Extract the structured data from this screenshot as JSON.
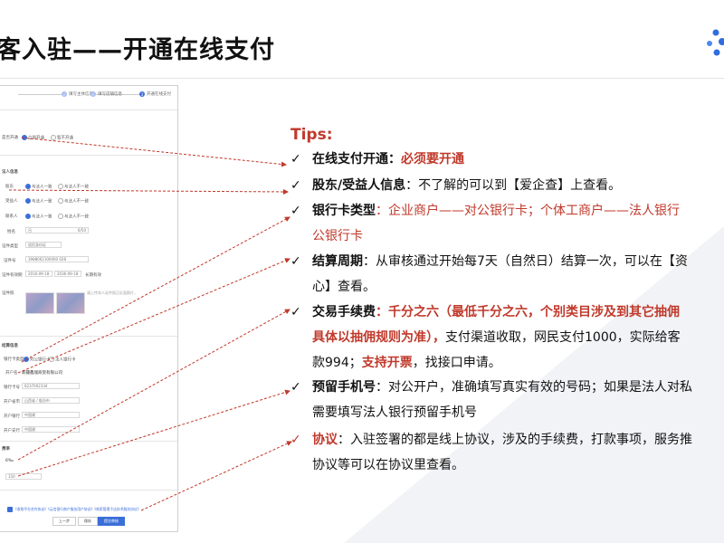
{
  "header": {
    "title": "客入驻——开通在线支付"
  },
  "form": {
    "steps": [
      "填写主体信息",
      "填写店铺信息",
      "开通在线支付"
    ],
    "open_label": "是否开通",
    "open_options": [
      "立即开通",
      "暂不开通"
    ],
    "legal_title": "法人信息",
    "holder_rows": [
      {
        "label": "股东",
        "opt1": "与法人一致",
        "opt2": "与法人不一致"
      },
      {
        "label": "受益人",
        "opt1": "与法人一致",
        "opt2": "与法人不一致"
      },
      {
        "label": "联系人",
        "opt1": "与法人一致",
        "opt2": "与法人不一致"
      }
    ],
    "name_label": "姓名",
    "name_value": "吕",
    "name_counter": "6/50",
    "id_type_label": "证件类型",
    "id_type_value": "居民身份证",
    "id_no_label": "证件号",
    "id_no_value": "3988002100000",
    "id_no_suffix": "028",
    "validity_label": "证件有效期",
    "validity_start": "2016-09-18",
    "validity_end": "2036-09-18",
    "validity_long": "长期有效",
    "photo_label": "证件照",
    "photo_hint": "请上传本人证件照正反面照片，",
    "settle_title": "结算信息",
    "card_type_label": "银行卡类型",
    "card_type_opt1": "对公银行卡",
    "card_type_opt2": "法人银行卡",
    "account_holder_label": "开户名",
    "account_holder_value": "新疆鑫瑞商贸有限公司",
    "card_no_label": "银行卡号",
    "card_no_value": "6237002334",
    "bank_area_label": "开户省市",
    "bank_area_value": "山西省 / 临汾市",
    "bank_label": "开户银行",
    "bank_value": "中国建",
    "branch_label": "开户支行",
    "branch_value": "中国建",
    "fee_title": "费率",
    "fee_value": "6‰",
    "phone_value": "150",
    "agreement_text": "《收购平台合作协议》《云信银行商户服务用户协议》《商家管理子店技术服务协议》",
    "btn_prev": "上一步",
    "btn_save": "保存",
    "btn_submit": "提交审核"
  },
  "tips": {
    "title": "Tips:",
    "items": [
      {
        "key": "在线支付开通：",
        "value": "必须要开通"
      },
      {
        "key": "股东/受益人信息",
        "value": "：不了解的可以到【爱企查】上查看。"
      },
      {
        "key": "银行卡类型",
        "value": "：企业商户——对公银行卡；个体工商户——法人银行",
        "cont": "公银行卡"
      },
      {
        "key": "结算周期",
        "value": "：从审核通过开始每7天（自然日）结算一次，可以在【资",
        "cont": "心】查看。"
      },
      {
        "key": "交易手续费",
        "value_red": "：千分之六（最低千分之六，个别类目涉及到其它抽佣",
        "cont_red": "具体以抽佣规则为准），",
        "cont_black": "支付渠道收取，网民支付1000，实际给客",
        "cont2_a": "款994；",
        "cont2_red": "支持开票",
        "cont2_b": "，找接口申请。"
      },
      {
        "key": "预留手机号",
        "value": "：对公开户，准确填写真实有效的号码；如果是法人对私",
        "cont": "需要填写法人银行预留手机号"
      },
      {
        "key": "协议",
        "value": "：入驻签署的都是线上协议，涉及的手续费，打款事项，服务推",
        "cont": "协议等可以在协议里查看。"
      }
    ]
  },
  "colors": {
    "accent": "#c0392b",
    "primary": "#3b6fd8",
    "logo": "#2f6de0"
  }
}
